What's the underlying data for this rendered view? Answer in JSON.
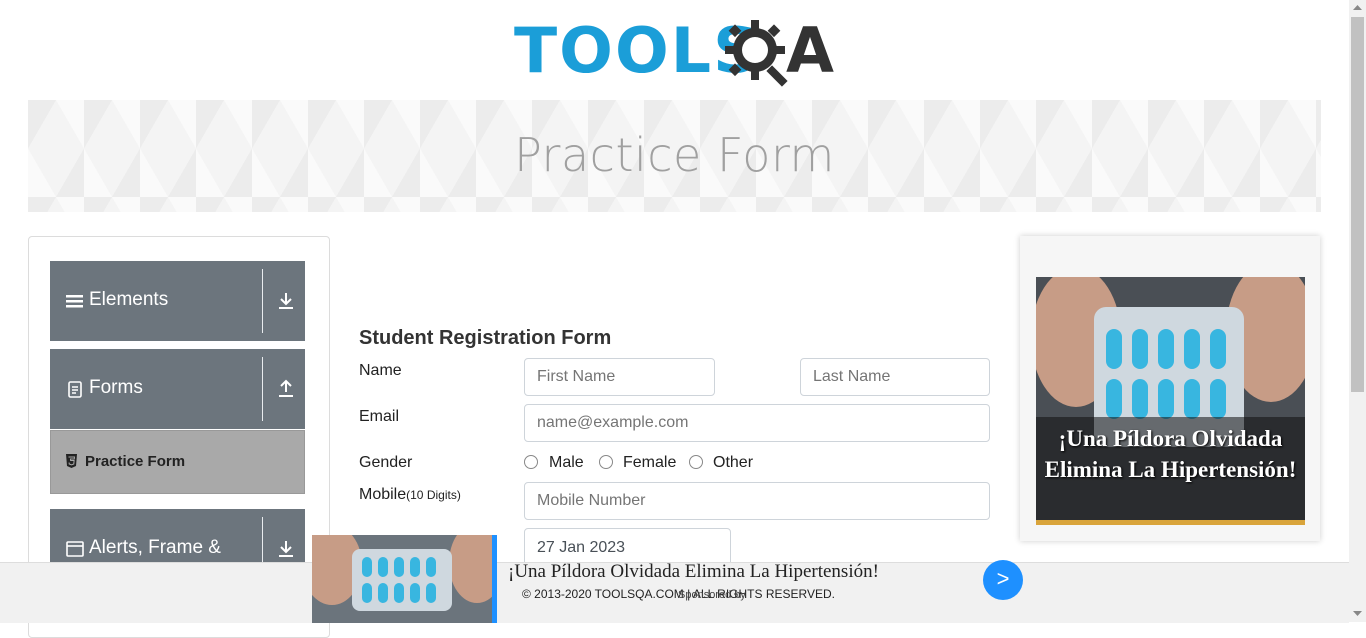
{
  "header": {
    "logo_text": "TOOLS",
    "logo_text_end": "A"
  },
  "banner": {
    "title": "Practice Form"
  },
  "sidebar": {
    "groups": [
      {
        "label": "Elements",
        "icon": "hamburger-icon",
        "arrow": "download-arrow-icon"
      },
      {
        "label": "Forms",
        "icon": "document-icon",
        "arrow": "upload-arrow-icon"
      },
      {
        "label": "Alerts, Frame &",
        "icon": "window-icon",
        "arrow": "download-arrow-icon"
      }
    ],
    "active_item": {
      "label": "Practice Form",
      "icon": "html5-icon"
    }
  },
  "form": {
    "title": "Student Registration Form",
    "name_label": "Name",
    "first_name_placeholder": "First Name",
    "last_name_placeholder": "Last Name",
    "email_label": "Email",
    "email_placeholder": "name@example.com",
    "gender_label": "Gender",
    "gender_options": [
      "Male",
      "Female",
      "Other"
    ],
    "mobile_label": "Mobile",
    "mobile_hint": "(10 Digits)",
    "mobile_placeholder": "Mobile Number",
    "dob_value": "27 Jan 2023"
  },
  "right_ad": {
    "text": "¡Una Píldora Olvidada Elimina La Hipertensión!"
  },
  "bottom_ad": {
    "headline": "¡Una Píldora Olvidada Elimina La Hipertensión!",
    "copyright": "© 2013-2020 TOOLSQA.COM | ALL RIGHTS RESERVED.",
    "sponsored": "Sponsored by",
    "button": ">"
  },
  "colors": {
    "sidebar_group": "#6c757d",
    "active_item": "#a9a9a9",
    "logo_blue": "#1b9ed8",
    "ad_button": "#1e90ff"
  }
}
